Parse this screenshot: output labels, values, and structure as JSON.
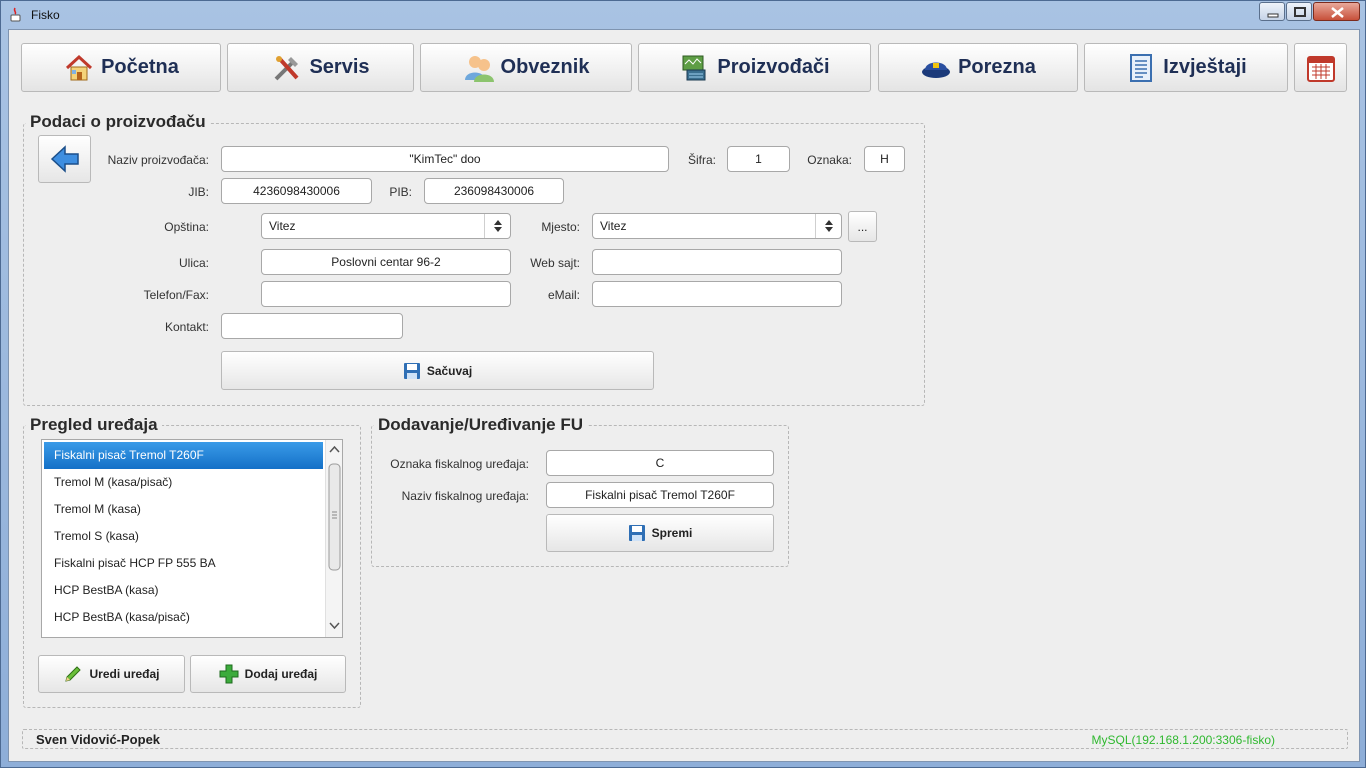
{
  "window": {
    "title": "Fisko"
  },
  "nav": {
    "pocetna": "Početna",
    "servis": "Servis",
    "obveznik": "Obveznik",
    "proizvodjaci": "Proizvođači",
    "porezna": "Porezna",
    "izvjestaji": "Izvještaji"
  },
  "producer": {
    "title": "Podaci o proizvođaču",
    "name_label": "Naziv proizvođača:",
    "name": "\"KimTec\" doo",
    "sifra_label": "Šifra:",
    "sifra": "1",
    "oznaka_label": "Oznaka:",
    "oznaka": "H",
    "jib_label": "JIB:",
    "jib": "4236098430006",
    "pib_label": "PIB:",
    "pib": "236098430006",
    "opstina_label": "Opština:",
    "opstina": "Vitez",
    "mjesto_label": "Mjesto:",
    "mjesto": "Vitez",
    "more_label": "...",
    "ulica_label": "Ulica:",
    "ulica": "Poslovni centar 96-2",
    "web_label": "Web sajt:",
    "web": "",
    "telefon_label": "Telefon/Fax:",
    "telefon": "",
    "email_label": "eMail:",
    "email": "",
    "kontakt_label": "Kontakt:",
    "kontakt": "",
    "save_label": "Sačuvaj"
  },
  "devices": {
    "title": "Pregled uređaja",
    "items": [
      "Fiskalni pisač Tremol T260F",
      "Tremol M (kasa/pisač)",
      "Tremol M (kasa)",
      "Tremol S (kasa)",
      "Fiskalni pisač HCP FP 555 BA",
      "HCP BestBA (kasa)",
      "HCP BestBA (kasa/pisač)"
    ],
    "selected_index": 0,
    "edit_label": "Uredi uređaj",
    "add_label": "Dodaj uređaj"
  },
  "fu": {
    "title": "Dodavanje/Uređivanje FU",
    "oznaka_label": "Oznaka fiskalnog uređaja:",
    "oznaka": "C",
    "naziv_label": "Naziv fiskalnog uređaja:",
    "naziv": "Fiskalni pisač Tremol T260F",
    "save_label": "Spremi"
  },
  "status": {
    "user": "Sven Vidović-Popek",
    "db": "MySQL(192.168.1.200:3306-fisko)"
  },
  "colors": {
    "selection": "#1a7fd6",
    "db_status": "#2fb82f",
    "nav_text": "#1f2f55"
  }
}
